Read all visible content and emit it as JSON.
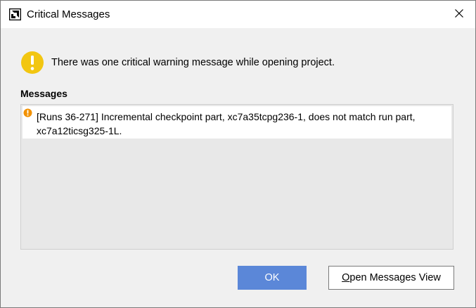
{
  "window": {
    "title": "Critical Messages",
    "icon": "amd-logo-icon",
    "close_icon": "close-icon"
  },
  "banner": {
    "icon": "warning-circle-icon",
    "icon_color": "#f2c611",
    "text": "There was one critical warning message while opening project."
  },
  "messages": {
    "label": "Messages",
    "items": [
      {
        "icon": "warning-small-icon",
        "icon_color": "#f29100",
        "text": "[Runs 36-271] Incremental checkpoint part, xc7a35tcpg236-1, does not match run part, xc7a12ticsg325-1L."
      }
    ]
  },
  "buttons": {
    "ok_label": "OK",
    "open_view_mnemonic": "O",
    "open_view_rest": "pen Messages View",
    "ok_color": "#5b87d8"
  }
}
